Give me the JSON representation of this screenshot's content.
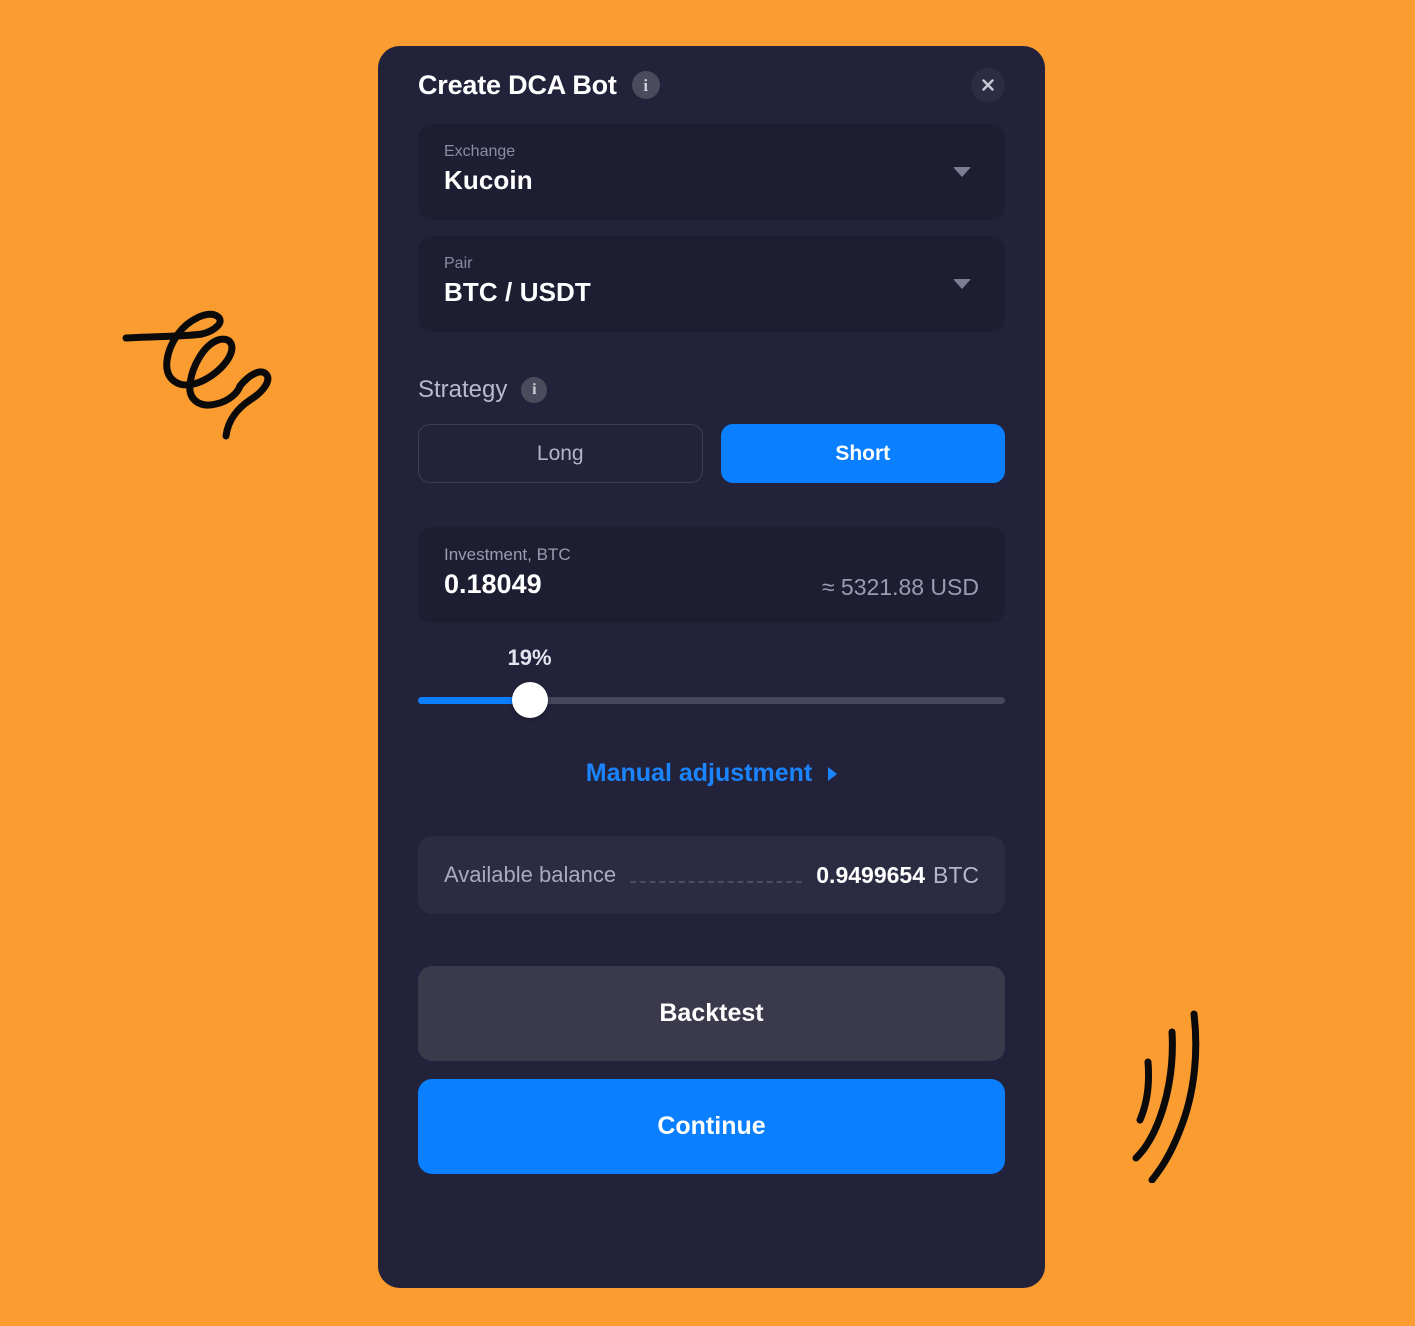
{
  "theme": {
    "background": "#fb9c31",
    "card_bg": "#22223a",
    "field_bg": "#1e1e33",
    "accent_blue": "#0a7fff",
    "text_primary": "#ffffff",
    "text_muted": "#9a9ab2"
  },
  "modal": {
    "title": "Create DCA Bot",
    "title_info_icon": "info-circle-icon",
    "close_icon": "close-icon"
  },
  "exchange": {
    "label": "Exchange",
    "value": "Kucoin",
    "caret_icon": "chevron-down-icon"
  },
  "pair": {
    "label": "Pair",
    "value": "BTC / USDT",
    "caret_icon": "chevron-down-icon"
  },
  "strategy": {
    "label": "Strategy",
    "info_icon": "info-circle-icon",
    "options": [
      {
        "label": "Long",
        "selected": false
      },
      {
        "label": "Short",
        "selected": true
      }
    ]
  },
  "investment": {
    "label": "Investment, BTC",
    "value": "0.18049",
    "approx": "≈ 5321.88 USD"
  },
  "slider": {
    "value_label": "19%",
    "percent": 19
  },
  "manual_adjustment": {
    "label": "Manual adjustment",
    "caret_icon": "chevron-right-icon"
  },
  "balance": {
    "label": "Available balance",
    "value": "0.9499654",
    "unit": "BTC"
  },
  "actions": {
    "backtest_label": "Backtest",
    "continue_label": "Continue"
  },
  "decorations": [
    {
      "name": "scribble-doodle"
    },
    {
      "name": "speed-lines-doodle"
    }
  ]
}
